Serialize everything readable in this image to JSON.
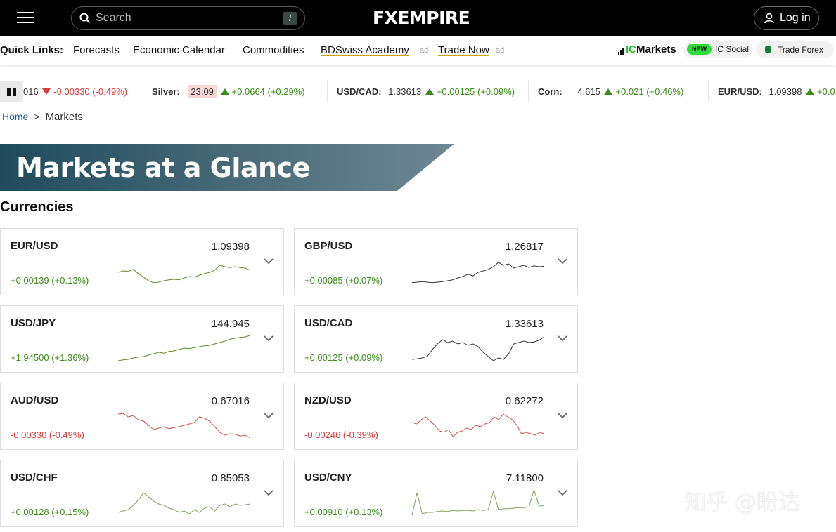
{
  "header": {
    "search_placeholder": "Search",
    "search_shortcut": "/",
    "logo_text": "FXEMPIRE",
    "login_label": "Log in"
  },
  "quick_links": {
    "title": "Quick Links:",
    "items": [
      {
        "label": "Forecasts"
      },
      {
        "label": "Economic Calendar"
      },
      {
        "label": "Commodities"
      },
      {
        "label": "BDSwiss Academy",
        "ad": "ad"
      },
      {
        "label": "Trade Now",
        "ad": "ad"
      }
    ],
    "partner_ic": "IC",
    "partner_markets": "Markets",
    "new_badge": "NEW",
    "ic_social": "IC Social",
    "trade_forex": "Trade Forex"
  },
  "ticker": [
    {
      "name": "",
      "value": "016",
      "dir": "down",
      "change": "-0.00330 (-0.49%)"
    },
    {
      "name": "Silver:",
      "value": "23.09",
      "dir": "up",
      "change": "+0.0664 (+0.29%)",
      "highlight": true
    },
    {
      "name": "USD/CAD:",
      "value": "1.33613",
      "dir": "up",
      "change": "+0.00125 (+0.09%)"
    },
    {
      "name": "Corn:",
      "value": "4.615",
      "dir": "up",
      "change": "+0.021 (+0.46%)"
    },
    {
      "name": "EUR/USD:",
      "value": "1.09398",
      "dir": "up",
      "change": "+0.0"
    }
  ],
  "breadcrumb": {
    "home": "Home",
    "sep": ">",
    "current": "Markets"
  },
  "page_title": "Markets at a Glance",
  "section_title": "Currencies",
  "colors": {
    "up": "#3c8a1a",
    "down": "#d63a3a",
    "banner_start": "#1f4b5c",
    "banner_end": "#6f8794"
  },
  "cards": [
    {
      "pair": "EUR/USD",
      "price": "1.09398",
      "change": "+0.00139 (+0.13%)",
      "dir": "up",
      "spark": [
        0.55,
        0.5,
        0.52,
        0.45,
        0.6,
        0.72,
        0.85,
        0.92,
        0.9,
        0.85,
        0.82,
        0.8,
        0.82,
        0.75,
        0.7,
        0.72,
        0.65,
        0.6,
        0.55,
        0.48,
        0.3,
        0.35,
        0.38,
        0.35,
        0.38,
        0.4,
        0.48
      ],
      "spark_color": "#5b8f2b"
    },
    {
      "pair": "GBP/USD",
      "price": "1.26817",
      "change": "+0.00085 (+0.07%)",
      "dir": "up",
      "spark": [
        0.92,
        0.9,
        0.88,
        0.9,
        0.92,
        0.9,
        0.88,
        0.85,
        0.82,
        0.75,
        0.7,
        0.62,
        0.68,
        0.55,
        0.5,
        0.45,
        0.35,
        0.2,
        0.3,
        0.25,
        0.4,
        0.35,
        0.3,
        0.38,
        0.32,
        0.35,
        0.33
      ],
      "spark_color": "#333333"
    },
    {
      "pair": "USD/JPY",
      "price": "144.945",
      "change": "+1.94500 (+1.36%)",
      "dir": "up",
      "spark": [
        0.95,
        0.92,
        0.9,
        0.85,
        0.82,
        0.8,
        0.75,
        0.7,
        0.65,
        0.68,
        0.62,
        0.6,
        0.55,
        0.5,
        0.52,
        0.48,
        0.45,
        0.42,
        0.4,
        0.35,
        0.3,
        0.25,
        0.18,
        0.15,
        0.12,
        0.1,
        0.05
      ],
      "spark_color": "#5b8f2b"
    },
    {
      "pair": "USD/CAD",
      "price": "1.33613",
      "change": "+0.00125 (+0.09%)",
      "dir": "up",
      "spark": [
        0.9,
        0.88,
        0.85,
        0.8,
        0.55,
        0.35,
        0.2,
        0.3,
        0.25,
        0.35,
        0.3,
        0.4,
        0.35,
        0.45,
        0.65,
        0.8,
        0.95,
        0.85,
        0.9,
        0.7,
        0.35,
        0.3,
        0.25,
        0.3,
        0.28,
        0.22,
        0.1
      ],
      "spark_color": "#333333"
    },
    {
      "pair": "AUD/USD",
      "price": "0.67016",
      "change": "-0.00330 (-0.49%)",
      "dir": "down",
      "spark": [
        0.1,
        0.08,
        0.2,
        0.15,
        0.3,
        0.35,
        0.5,
        0.65,
        0.6,
        0.55,
        0.62,
        0.58,
        0.55,
        0.5,
        0.45,
        0.4,
        0.2,
        0.25,
        0.35,
        0.55,
        0.75,
        0.85,
        0.8,
        0.82,
        0.88,
        0.85,
        0.95
      ],
      "spark_color": "#d14f4f"
    },
    {
      "pair": "NZD/USD",
      "price": "0.62272",
      "change": "-0.00246 (-0.39%)",
      "dir": "down",
      "spark": [
        0.4,
        0.45,
        0.3,
        0.2,
        0.35,
        0.5,
        0.7,
        0.75,
        0.65,
        0.9,
        0.75,
        0.7,
        0.6,
        0.65,
        0.5,
        0.55,
        0.45,
        0.4,
        0.2,
        0.3,
        0.1,
        0.2,
        0.3,
        0.5,
        0.8,
        0.75,
        0.8,
        0.85,
        0.75,
        0.8
      ],
      "spark_color": "#d14f4f"
    },
    {
      "pair": "USD/CHF",
      "price": "0.85053",
      "change": "+0.00128 (+0.15%)",
      "dir": "up",
      "spark": [
        0.85,
        0.8,
        0.75,
        0.6,
        0.4,
        0.15,
        0.3,
        0.45,
        0.55,
        0.6,
        0.7,
        0.75,
        0.85,
        0.8,
        0.9,
        0.75,
        0.85,
        0.7,
        0.65,
        0.8,
        0.6,
        0.55,
        0.65,
        0.55,
        0.6,
        0.58,
        0.55
      ],
      "spark_color": "#7da35a"
    },
    {
      "pair": "USD/CNY",
      "price": "7.11800",
      "change": "+0.00910 (+0.13%)",
      "dir": "up",
      "spark": [
        0.95,
        0.15,
        0.9,
        0.85,
        0.85,
        0.82,
        0.8,
        0.82,
        0.78,
        0.8,
        0.78,
        0.78,
        0.8,
        0.75,
        0.78,
        0.75,
        0.1,
        0.75,
        0.72,
        0.72,
        0.7,
        0.68,
        0.68,
        0.65,
        0.05,
        0.62,
        0.62
      ],
      "spark_color": "#7da35a"
    }
  ],
  "watermark": "知乎 @盼达"
}
